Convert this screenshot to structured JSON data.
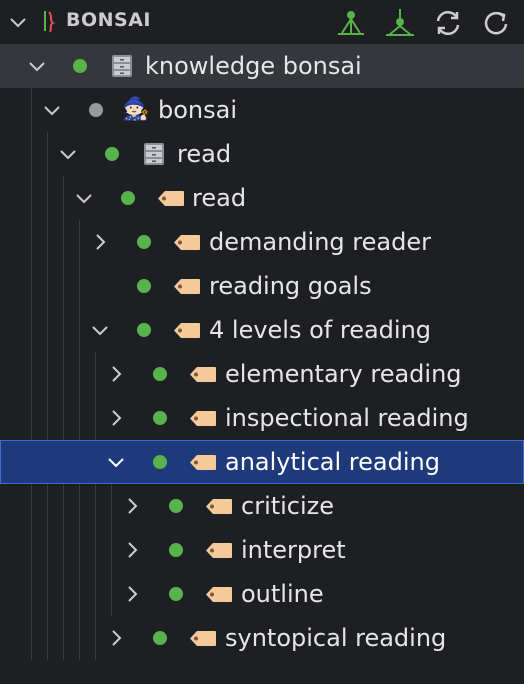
{
  "header": {
    "title": "BONSAI",
    "icons": [
      "collapse-chevron-icon",
      "bonsai-logo-icon",
      "tree-view-icon",
      "hierarchy-icon",
      "sync-icon",
      "refresh-icon"
    ]
  },
  "tree": {
    "items": [
      {
        "label": "knowledge bonsai",
        "icon": "filing-cabinet-icon",
        "dot": "green",
        "expanded": true
      },
      {
        "label": "bonsai",
        "icon": "mage-emoji-icon",
        "dot": "grey",
        "expanded": true
      },
      {
        "label": "read",
        "icon": "filing-cabinet-icon",
        "dot": "green",
        "expanded": true
      },
      {
        "label": "read",
        "icon": "tag-icon",
        "dot": "green",
        "expanded": true
      },
      {
        "label": "demanding reader",
        "icon": "tag-icon",
        "dot": "green",
        "expanded": false
      },
      {
        "label": "reading goals",
        "icon": "tag-icon",
        "dot": "green",
        "expanded": null
      },
      {
        "label": "4 levels of reading",
        "icon": "tag-icon",
        "dot": "green",
        "expanded": true
      },
      {
        "label": "elementary reading",
        "icon": "tag-icon",
        "dot": "green",
        "expanded": false
      },
      {
        "label": "inspectional reading",
        "icon": "tag-icon",
        "dot": "green",
        "expanded": false
      },
      {
        "label": "analytical reading",
        "icon": "tag-icon",
        "dot": "green",
        "expanded": true,
        "selected": true
      },
      {
        "label": "criticize",
        "icon": "tag-icon",
        "dot": "green",
        "expanded": false
      },
      {
        "label": "interpret",
        "icon": "tag-icon",
        "dot": "green",
        "expanded": false
      },
      {
        "label": "outline",
        "icon": "tag-icon",
        "dot": "green",
        "expanded": false
      },
      {
        "label": "syntopical reading",
        "icon": "tag-icon",
        "dot": "green",
        "expanded": false
      }
    ]
  },
  "colors": {
    "accent_green": "#58b34a",
    "selection": "#1f3a7a",
    "selection_border": "#3d6bd1"
  }
}
